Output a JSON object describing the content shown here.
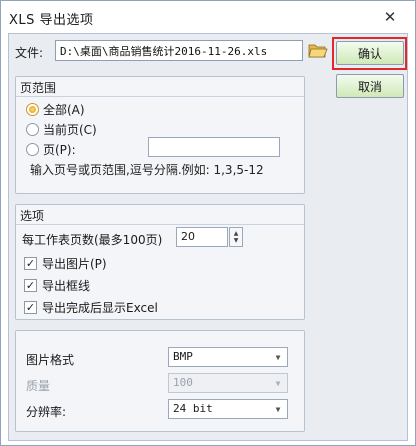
{
  "window": {
    "title": "XLS 导出选项",
    "close_glyph": "✕"
  },
  "file": {
    "label": "文件:",
    "path": "D:\\桌面\\商品销售统计2016-11-26.xls",
    "browse_icon": "folder-open-icon"
  },
  "buttons": {
    "ok": "确认",
    "cancel": "取消"
  },
  "page_range": {
    "title": "页范围",
    "options": [
      {
        "label": "全部(A)",
        "selected": true
      },
      {
        "label": "当前页(C)",
        "selected": false
      },
      {
        "label": "页(P):",
        "selected": false
      }
    ],
    "pages_value": "",
    "hint": "输入页号或页范围,逗号分隔.例如: 1,3,5-12"
  },
  "options": {
    "title": "选项",
    "pages_per_sheet_label": "每工作表页数(最多100页)",
    "pages_per_sheet_value": "20",
    "checks": [
      {
        "label": "导出图片(P)",
        "checked": true
      },
      {
        "label": "导出框线",
        "checked": true
      },
      {
        "label": "导出完成后显示Excel",
        "checked": true
      }
    ]
  },
  "image": {
    "format_label": "图片格式",
    "format_value": "BMP",
    "quality_label": "质量",
    "quality_value": "100",
    "resolution_label": "分辨率:",
    "resolution_value": "24 bit"
  },
  "colors": {
    "highlight": "#e0282d",
    "button_top": "#f4fbee",
    "button_bottom": "#cfe9b8",
    "client_bg": "#e9edf2"
  }
}
